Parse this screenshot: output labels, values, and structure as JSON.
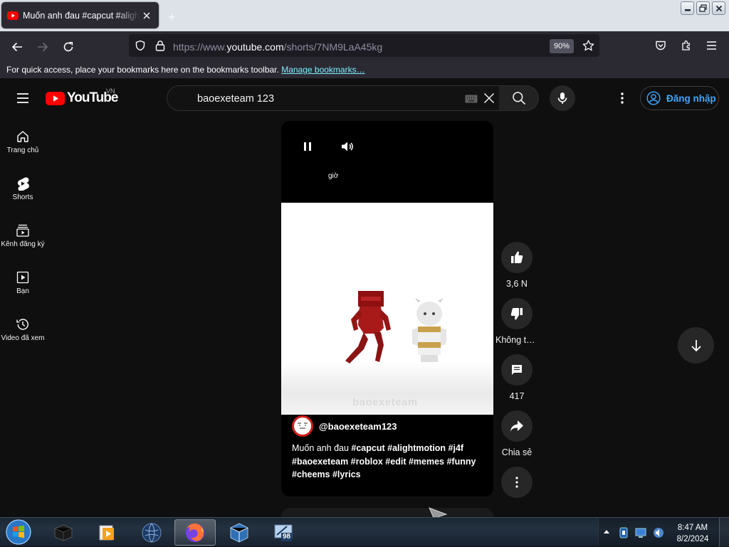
{
  "browser": {
    "tab_title": "Muốn anh đau #capcut #alightmotion",
    "new_tab_label": "+",
    "url_prefix": "https://www.",
    "url_domain": "youtube.com",
    "url_path": "/shorts/7NM9LaA45kg",
    "zoom": "90%",
    "bookmarks_message": "For quick access, place your bookmarks here on the bookmarks toolbar.",
    "bookmarks_link": "Manage bookmarks…"
  },
  "youtube": {
    "logo_text": "YouTube",
    "region": "VN",
    "search_query": "baoexeteam 123",
    "signin_label": "Đăng nhập",
    "sidebar": [
      {
        "label": "Trang chủ",
        "icon": "home-icon"
      },
      {
        "label": "Shorts",
        "icon": "shorts-icon"
      },
      {
        "label": "Kênh đăng ký",
        "icon": "subscriptions-icon"
      },
      {
        "label": "Bạn",
        "icon": "you-icon"
      },
      {
        "label": "Video đã xem",
        "icon": "history-icon"
      }
    ]
  },
  "short": {
    "caption_overlay": "giờ",
    "watermark": "baoexeteam",
    "channel": "@baoexeteam123",
    "description_text": "Muốn anh đau ",
    "description_tags": "#capcut #alightmotion #j4f #baoexeteam #roblox #edit #memes #funny #cheems #lyrics"
  },
  "actions": {
    "like_count": "3,6 N",
    "dislike_label": "Không thích",
    "comment_count": "417",
    "share_label": "Chia sẻ"
  },
  "taskbar": {
    "time": "8:47 AM",
    "date": "8/2/2024",
    "vb_badge": "98"
  }
}
